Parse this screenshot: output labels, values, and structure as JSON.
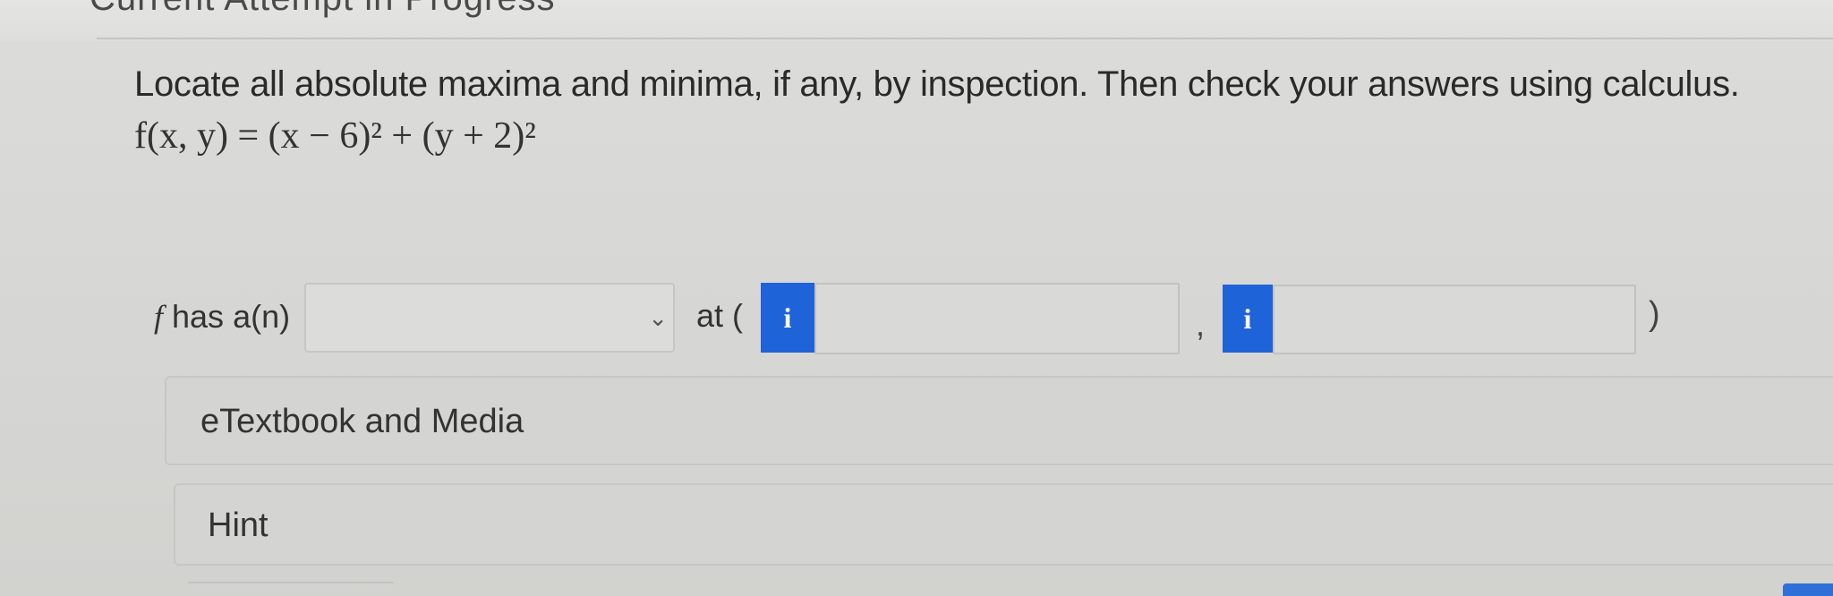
{
  "header": {
    "heading": "Current Attempt in Progress"
  },
  "question": {
    "prompt": "Locate all absolute maxima and minima, if any, by inspection. Then check your answers using calculus.",
    "formula": "f(x, y) = (x − 6)² + (y + 2)²"
  },
  "answer_row": {
    "prefix_f": "f",
    "prefix_rest": " has a(n)",
    "select_value": "",
    "chevron": "⌄",
    "at_label": "at (",
    "info_icon": "i",
    "x_value": "",
    "comma": ",",
    "y_value": "",
    "close_paren": ")"
  },
  "panels": {
    "etextbook_label": "eTextbook and Media",
    "hint_label": "Hint"
  },
  "colors": {
    "info_button": "#1f63d9",
    "background": "#d8d8d6"
  }
}
